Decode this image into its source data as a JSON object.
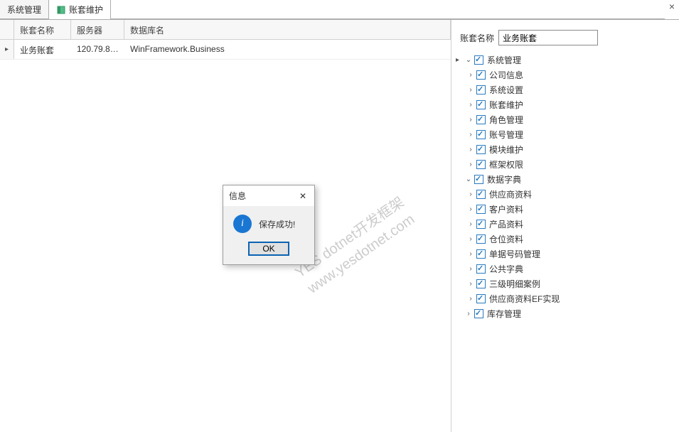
{
  "tabs": [
    {
      "label": "系统管理"
    },
    {
      "label": "账套维护"
    }
  ],
  "close_icon": "×",
  "grid": {
    "columns": {
      "name": "账套名称",
      "server": "服务器",
      "db": "数据库名"
    },
    "rows": [
      {
        "name": "业务账套",
        "server": "120.79.85...",
        "db": "WinFramework.Business"
      }
    ]
  },
  "form": {
    "name_label": "账套名称",
    "name_value": "业务账套"
  },
  "tree": [
    {
      "level": 0,
      "exp": "open",
      "checked": true,
      "label": "系统管理"
    },
    {
      "level": 1,
      "exp": "closed",
      "checked": true,
      "label": "公司信息"
    },
    {
      "level": 1,
      "exp": "closed",
      "checked": true,
      "label": "系统设置"
    },
    {
      "level": 1,
      "exp": "closed",
      "checked": true,
      "label": "账套维护"
    },
    {
      "level": 1,
      "exp": "closed",
      "checked": true,
      "label": "角色管理"
    },
    {
      "level": 1,
      "exp": "closed",
      "checked": true,
      "label": "账号管理"
    },
    {
      "level": 1,
      "exp": "closed",
      "checked": true,
      "label": "模块维护"
    },
    {
      "level": 1,
      "exp": "closed",
      "checked": true,
      "label": "框架权限"
    },
    {
      "level": 0,
      "exp": "open",
      "checked": true,
      "label": "数据字典"
    },
    {
      "level": 1,
      "exp": "closed",
      "checked": true,
      "label": "供应商资料"
    },
    {
      "level": 1,
      "exp": "closed",
      "checked": true,
      "label": "客户资料"
    },
    {
      "level": 1,
      "exp": "closed",
      "checked": true,
      "label": "产品资料"
    },
    {
      "level": 1,
      "exp": "closed",
      "checked": true,
      "label": "仓位资料"
    },
    {
      "level": 1,
      "exp": "closed",
      "checked": true,
      "label": "单据号码管理"
    },
    {
      "level": 1,
      "exp": "closed",
      "checked": true,
      "label": "公共字典"
    },
    {
      "level": 1,
      "exp": "closed",
      "checked": true,
      "label": "三级明细案例"
    },
    {
      "level": 1,
      "exp": "closed",
      "checked": true,
      "label": "供应商资料EF实现"
    },
    {
      "level": 0,
      "exp": "closed",
      "checked": true,
      "label": "库存管理"
    }
  ],
  "dialog": {
    "title": "信息",
    "message": "保存成功!",
    "ok_label": "OK"
  },
  "watermark": {
    "line1": "YES  dotnet开发框架",
    "line2": "www.yesdotnet.com"
  }
}
